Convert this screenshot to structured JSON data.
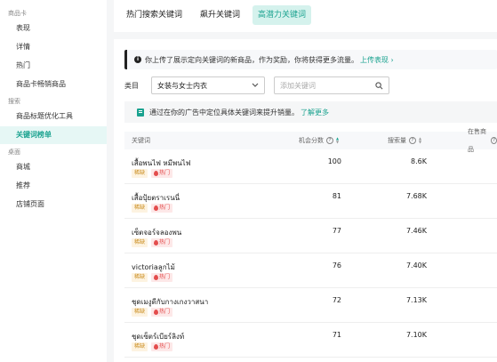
{
  "sidebar": {
    "sections": [
      {
        "title": "商品卡",
        "items": [
          "表现",
          "详情",
          "热门",
          "商品卡畅销商品"
        ]
      },
      {
        "title": "搜索",
        "items": [
          "商品标题优化工具",
          "关键词榜单"
        ]
      },
      {
        "title": "桌面",
        "items": [
          "商城",
          "推荐",
          "店铺页面"
        ]
      }
    ],
    "active_item": "关键词榜单"
  },
  "tabs": [
    "热门搜索关键词",
    "飙升关键词",
    "高潜力关键词"
  ],
  "active_tab": "高潜力关键词",
  "notice": {
    "text": "你上传了展示定向关键词的新商品，作为奖励，你将获得更多流量。",
    "link": "上传表现 ›"
  },
  "filters": {
    "category_label": "类目",
    "category_value": "女装与女士内衣",
    "search_placeholder": "添加关键词"
  },
  "tip": {
    "text": "通过在你的广告中定位具体关键词来提升销量。",
    "link": "了解更多"
  },
  "table": {
    "headers": {
      "keyword": "关键词",
      "opportunity": "机会分数",
      "search_volume": "搜索量",
      "products": "在售商品"
    },
    "tag_short": "稀缺",
    "tag_hot": "热门",
    "rows": [
      {
        "keyword": "เสื้อพนไฟ หมีพนไฟ",
        "score": "100",
        "volume": "8.6K"
      },
      {
        "keyword": "เสื้อปุ้ยตราเรนนี่",
        "score": "81",
        "volume": "7.68K"
      },
      {
        "keyword": "เซ็ตจอร์จลองพน",
        "score": "77",
        "volume": "7.46K"
      },
      {
        "keyword": "victoriaลูกไม้",
        "score": "76",
        "volume": "7.40K"
      },
      {
        "keyword": "ชุดเมงูดีกับกางเกงวาสนา",
        "score": "72",
        "volume": "7.13K"
      },
      {
        "keyword": "ชุดเซ็ตร์เบียร์ลิงท์",
        "score": "71",
        "volume": "7.10K"
      }
    ]
  }
}
